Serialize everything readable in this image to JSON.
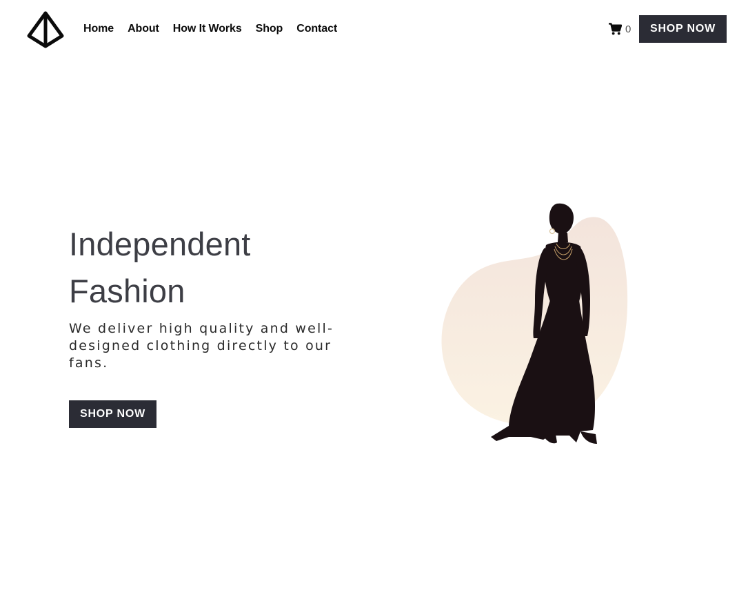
{
  "header": {
    "logo_icon": "diamond-logo-icon",
    "nav": [
      {
        "label": "Home"
      },
      {
        "label": "About"
      },
      {
        "label": "How It Works"
      },
      {
        "label": "Shop"
      },
      {
        "label": "Contact"
      }
    ],
    "cart": {
      "icon": "cart-icon",
      "count": "0"
    },
    "shop_now_label": "SHOP NOW"
  },
  "hero": {
    "title_line1": "Independent",
    "title_line2": "Fashion",
    "subtitle": "We deliver high quality and well-designed clothing directly to our fans.",
    "shop_now_label": "SHOP NOW",
    "image": "model-in-black-dress-image"
  },
  "colors": {
    "button_bg": "#2b2c35",
    "blob_top": "#f3e4dc",
    "blob_bottom": "#fbf2e3",
    "title": "#3d3e45"
  }
}
